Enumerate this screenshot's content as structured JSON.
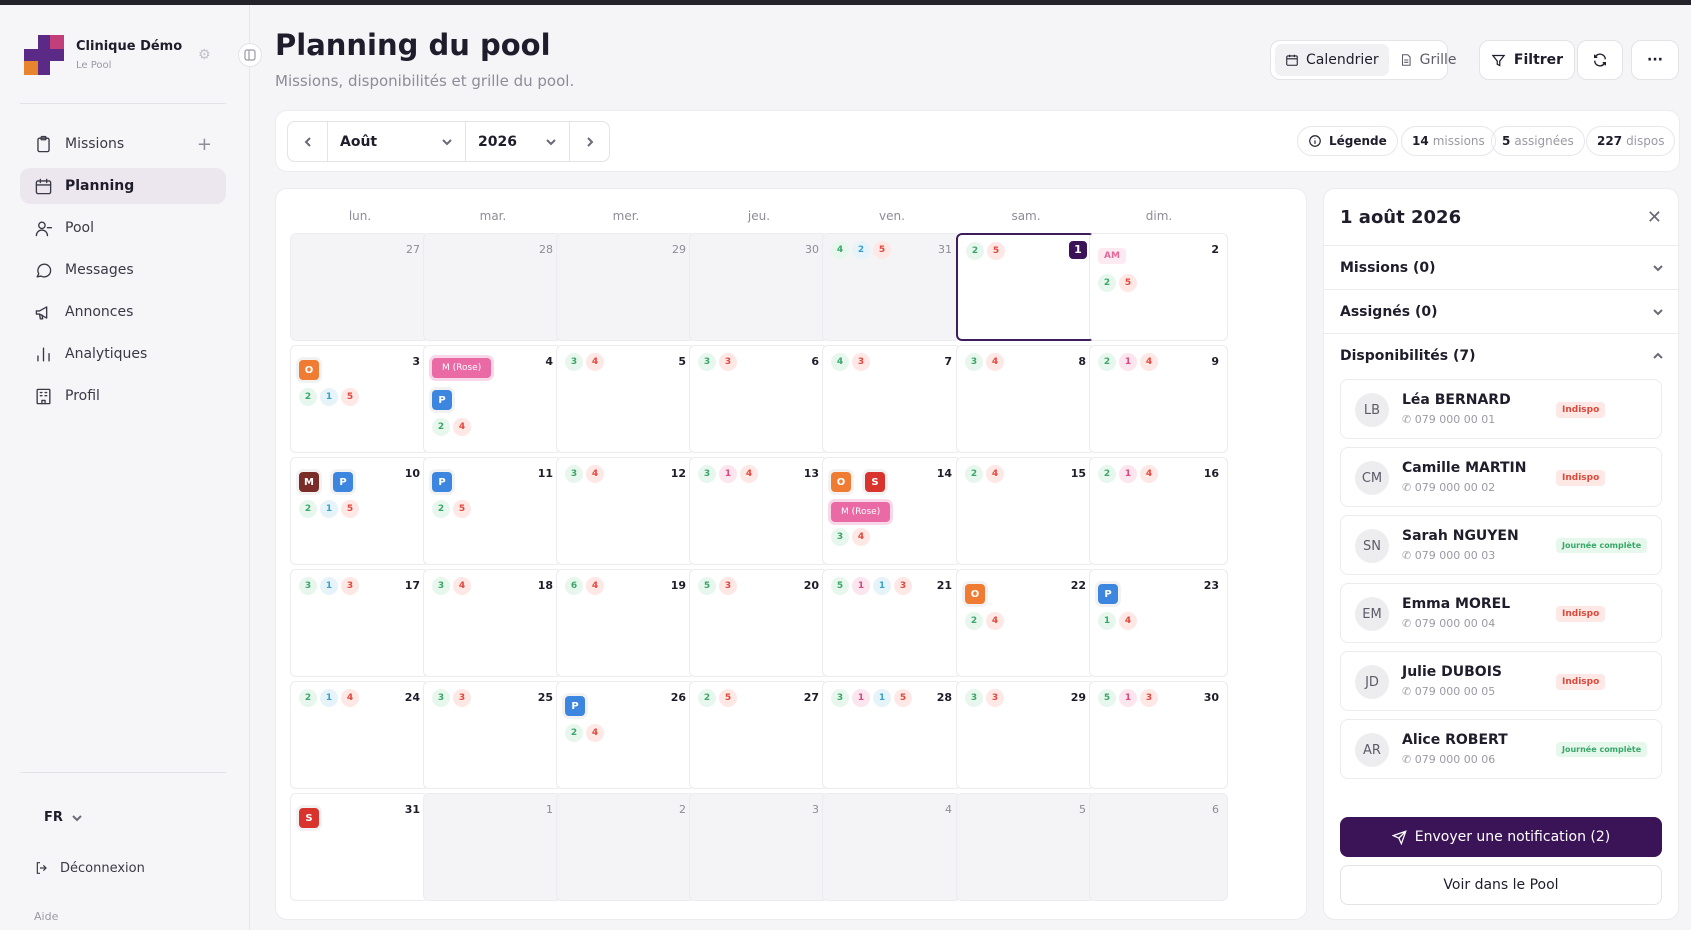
{
  "brand": {
    "name": "Clinique Démo",
    "subtitle": "Le Pool"
  },
  "sidebar": {
    "items": [
      {
        "label": "Missions",
        "icon": "clipboard-icon"
      },
      {
        "label": "Planning",
        "icon": "calendar-icon"
      },
      {
        "label": "Pool",
        "icon": "user-icon"
      },
      {
        "label": "Messages",
        "icon": "chat-icon"
      },
      {
        "label": "Annonces",
        "icon": "megaphone-icon"
      },
      {
        "label": "Analytiques",
        "icon": "bar-chart-icon"
      },
      {
        "label": "Profil",
        "icon": "building-icon"
      }
    ],
    "active": "Planning",
    "language": "FR",
    "logout": "Déconnexion",
    "help": "Aide"
  },
  "header": {
    "title": "Planning du pool",
    "subtitle": "Missions, disponibilités et grille du pool.",
    "view_calendar": "Calendrier",
    "view_grid": "Grille",
    "filter": "Filtrer",
    "more": "···"
  },
  "toolbar": {
    "month": "Août",
    "year": "2026",
    "legend": "Légende",
    "stats": [
      {
        "value": "14",
        "label": "missions"
      },
      {
        "value": "5",
        "label": "assignées"
      },
      {
        "value": "227",
        "label": "dispos"
      }
    ]
  },
  "calendar": {
    "weekdays": [
      "lun.",
      "mar.",
      "mer.",
      "jeu.",
      "ven.",
      "sam.",
      "dim."
    ],
    "days": [
      {
        "n": "27",
        "other": true
      },
      {
        "n": "28",
        "other": true
      },
      {
        "n": "29",
        "other": true
      },
      {
        "n": "30",
        "other": true
      },
      {
        "n": "31",
        "other": true,
        "counts": [
          [
            "g",
            "4"
          ],
          [
            "b",
            "2"
          ],
          [
            "r",
            "5"
          ]
        ]
      },
      {
        "n": "1",
        "sel": true,
        "counts": [
          [
            "g",
            "2"
          ],
          [
            "r",
            "5"
          ]
        ]
      },
      {
        "n": "2",
        "am": "AM",
        "counts": [
          [
            "g",
            "2"
          ],
          [
            "r",
            "5"
          ]
        ]
      },
      {
        "n": "3",
        "chips": [
          [
            "o",
            "O"
          ]
        ],
        "counts": [
          [
            "g",
            "2"
          ],
          [
            "b",
            "1"
          ],
          [
            "r",
            "5"
          ]
        ]
      },
      {
        "n": "4",
        "rose": "M (Rose)",
        "chips": [
          [
            "pb",
            "P"
          ]
        ],
        "counts": [
          [
            "g",
            "2"
          ],
          [
            "r",
            "4"
          ]
        ]
      },
      {
        "n": "5",
        "counts": [
          [
            "g",
            "3"
          ],
          [
            "r",
            "4"
          ]
        ]
      },
      {
        "n": "6",
        "counts": [
          [
            "g",
            "3"
          ],
          [
            "r",
            "3"
          ]
        ]
      },
      {
        "n": "7",
        "counts": [
          [
            "g",
            "4"
          ],
          [
            "r",
            "3"
          ]
        ]
      },
      {
        "n": "8",
        "counts": [
          [
            "g",
            "3"
          ],
          [
            "r",
            "4"
          ]
        ]
      },
      {
        "n": "9",
        "counts": [
          [
            "g",
            "2"
          ],
          [
            "p",
            "1"
          ],
          [
            "r",
            "4"
          ]
        ]
      },
      {
        "n": "10",
        "chips": [
          [
            "m",
            "M"
          ],
          [
            "pb",
            "P"
          ]
        ],
        "counts": [
          [
            "g",
            "2"
          ],
          [
            "b",
            "1"
          ],
          [
            "r",
            "5"
          ]
        ]
      },
      {
        "n": "11",
        "chips": [
          [
            "pb",
            "P"
          ]
        ],
        "counts": [
          [
            "g",
            "2"
          ],
          [
            "r",
            "5"
          ]
        ]
      },
      {
        "n": "12",
        "counts": [
          [
            "g",
            "3"
          ],
          [
            "r",
            "4"
          ]
        ]
      },
      {
        "n": "13",
        "counts": [
          [
            "g",
            "3"
          ],
          [
            "p",
            "1"
          ],
          [
            "r",
            "4"
          ]
        ]
      },
      {
        "n": "14",
        "chips": [
          [
            "o",
            "O"
          ],
          [
            "s",
            "S"
          ]
        ],
        "rose": "M (Rose)",
        "counts": [
          [
            "g",
            "3"
          ],
          [
            "r",
            "4"
          ]
        ]
      },
      {
        "n": "15",
        "counts": [
          [
            "g",
            "2"
          ],
          [
            "r",
            "4"
          ]
        ]
      },
      {
        "n": "16",
        "counts": [
          [
            "g",
            "2"
          ],
          [
            "p",
            "1"
          ],
          [
            "r",
            "4"
          ]
        ]
      },
      {
        "n": "17",
        "counts": [
          [
            "g",
            "3"
          ],
          [
            "b",
            "1"
          ],
          [
            "r",
            "3"
          ]
        ]
      },
      {
        "n": "18",
        "counts": [
          [
            "g",
            "3"
          ],
          [
            "r",
            "4"
          ]
        ]
      },
      {
        "n": "19",
        "counts": [
          [
            "g",
            "6"
          ],
          [
            "r",
            "4"
          ]
        ]
      },
      {
        "n": "20",
        "counts": [
          [
            "g",
            "5"
          ],
          [
            "r",
            "3"
          ]
        ]
      },
      {
        "n": "21",
        "counts": [
          [
            "g",
            "5"
          ],
          [
            "p",
            "1"
          ],
          [
            "b",
            "1"
          ],
          [
            "r",
            "3"
          ]
        ]
      },
      {
        "n": "22",
        "chips": [
          [
            "o",
            "O"
          ]
        ],
        "counts": [
          [
            "g",
            "2"
          ],
          [
            "r",
            "4"
          ]
        ]
      },
      {
        "n": "23",
        "chips": [
          [
            "pb",
            "P"
          ]
        ],
        "counts": [
          [
            "g",
            "1"
          ],
          [
            "r",
            "4"
          ]
        ]
      },
      {
        "n": "24",
        "counts": [
          [
            "g",
            "2"
          ],
          [
            "b",
            "1"
          ],
          [
            "r",
            "4"
          ]
        ]
      },
      {
        "n": "25",
        "counts": [
          [
            "g",
            "3"
          ],
          [
            "r",
            "3"
          ]
        ]
      },
      {
        "n": "26",
        "chips": [
          [
            "pb",
            "P"
          ]
        ],
        "counts": [
          [
            "g",
            "2"
          ],
          [
            "r",
            "4"
          ]
        ]
      },
      {
        "n": "27",
        "counts": [
          [
            "g",
            "2"
          ],
          [
            "r",
            "5"
          ]
        ]
      },
      {
        "n": "28",
        "counts": [
          [
            "g",
            "3"
          ],
          [
            "p",
            "1"
          ],
          [
            "b",
            "1"
          ],
          [
            "r",
            "5"
          ]
        ]
      },
      {
        "n": "29",
        "counts": [
          [
            "g",
            "3"
          ],
          [
            "r",
            "3"
          ]
        ]
      },
      {
        "n": "30",
        "counts": [
          [
            "g",
            "5"
          ],
          [
            "p",
            "1"
          ],
          [
            "r",
            "3"
          ]
        ]
      },
      {
        "n": "31",
        "chips": [
          [
            "s",
            "S"
          ]
        ]
      },
      {
        "n": "1",
        "other": true
      },
      {
        "n": "2",
        "other": true
      },
      {
        "n": "3",
        "other": true
      },
      {
        "n": "4",
        "other": true
      },
      {
        "n": "5",
        "other": true
      },
      {
        "n": "6",
        "other": true
      }
    ]
  },
  "panel": {
    "title": "1 août 2026",
    "missions": "Missions (0)",
    "assigned": "Assignés (0)",
    "availabilities": "Disponibilités (7)",
    "people": [
      {
        "initials": "LB",
        "name": "Léa BERNARD",
        "phone": "079 000 00 01",
        "tag": "Indispo",
        "tag_type": "ind"
      },
      {
        "initials": "CM",
        "name": "Camille MARTIN",
        "phone": "079 000 00 02",
        "tag": "Indispo",
        "tag_type": "ind"
      },
      {
        "initials": "SN",
        "name": "Sarah NGUYEN",
        "phone": "079 000 00 03",
        "tag": "Journée complète",
        "tag_type": "full"
      },
      {
        "initials": "EM",
        "name": "Emma MOREL",
        "phone": "079 000 00 04",
        "tag": "Indispo",
        "tag_type": "ind"
      },
      {
        "initials": "JD",
        "name": "Julie DUBOIS",
        "phone": "079 000 00 05",
        "tag": "Indispo",
        "tag_type": "ind"
      },
      {
        "initials": "AR",
        "name": "Alice ROBERT",
        "phone": "079 000 00 06",
        "tag": "Journée complète",
        "tag_type": "full"
      }
    ],
    "notify": "Envoyer une notification (2)",
    "view_pool": "Voir dans le Pool"
  },
  "colors": {
    "accent": "#3b1458",
    "logo_orange": "#e8832e",
    "logo_purple": "#5b2a86"
  }
}
